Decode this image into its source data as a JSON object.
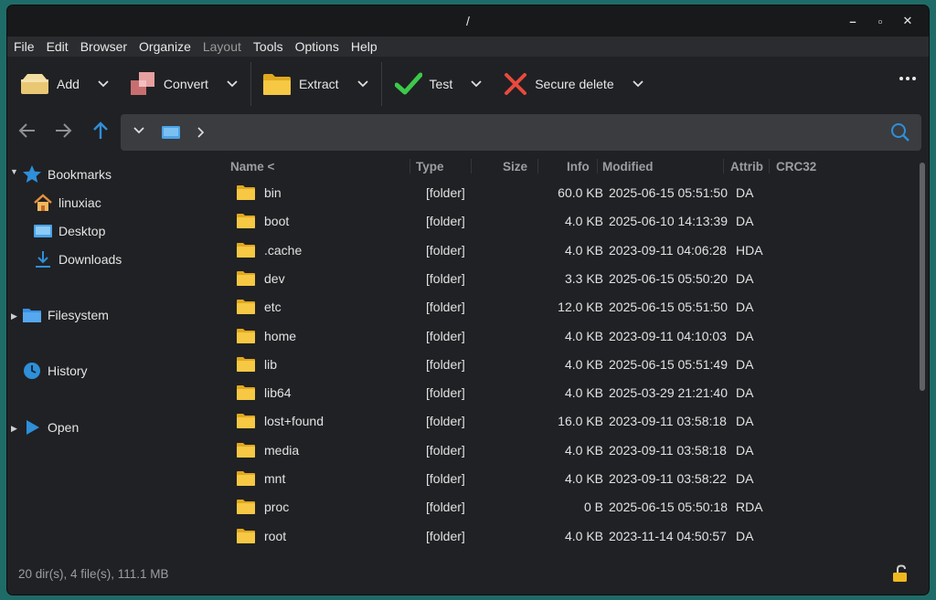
{
  "window": {
    "title": "/"
  },
  "menu": [
    "File",
    "Edit",
    "Browser",
    "Organize",
    "Layout",
    "Tools",
    "Options",
    "Help"
  ],
  "toolbar": {
    "add": "Add",
    "convert": "Convert",
    "extract": "Extract",
    "test": "Test",
    "secure_delete": "Secure delete"
  },
  "sidebar": {
    "bookmarks": "Bookmarks",
    "home": "linuxiac",
    "desktop": "Desktop",
    "downloads": "Downloads",
    "filesystem": "Filesystem",
    "history": "History",
    "open": "Open"
  },
  "columns": {
    "name": "Name <",
    "type": "Type",
    "size": "Size",
    "info": "Info",
    "modified": "Modified",
    "attrib": "Attrib",
    "crc": "CRC32"
  },
  "files": [
    {
      "name": "bin",
      "type": "[folder]",
      "size": "60.0 KB",
      "modified": "2025-06-15 05:51:50",
      "attrib": "DA"
    },
    {
      "name": "boot",
      "type": "[folder]",
      "size": "4.0 KB",
      "modified": "2025-06-10 14:13:39",
      "attrib": "DA"
    },
    {
      "name": ".cache",
      "type": "[folder]",
      "size": "4.0 KB",
      "modified": "2023-09-11 04:06:28",
      "attrib": "HDA"
    },
    {
      "name": "dev",
      "type": "[folder]",
      "size": "3.3 KB",
      "modified": "2025-06-15 05:50:20",
      "attrib": "DA"
    },
    {
      "name": "etc",
      "type": "[folder]",
      "size": "12.0 KB",
      "modified": "2025-06-15 05:51:50",
      "attrib": "DA"
    },
    {
      "name": "home",
      "type": "[folder]",
      "size": "4.0 KB",
      "modified": "2023-09-11 04:10:03",
      "attrib": "DA"
    },
    {
      "name": "lib",
      "type": "[folder]",
      "size": "4.0 KB",
      "modified": "2025-06-15 05:51:49",
      "attrib": "DA"
    },
    {
      "name": "lib64",
      "type": "[folder]",
      "size": "4.0 KB",
      "modified": "2025-03-29 21:21:40",
      "attrib": "DA"
    },
    {
      "name": "lost+found",
      "type": "[folder]",
      "size": "16.0 KB",
      "modified": "2023-09-11 03:58:18",
      "attrib": "DA"
    },
    {
      "name": "media",
      "type": "[folder]",
      "size": "4.0 KB",
      "modified": "2023-09-11 03:58:18",
      "attrib": "DA"
    },
    {
      "name": "mnt",
      "type": "[folder]",
      "size": "4.0 KB",
      "modified": "2023-09-11 03:58:22",
      "attrib": "DA"
    },
    {
      "name": "proc",
      "type": "[folder]",
      "size": "0 B",
      "modified": "2025-06-15 05:50:18",
      "attrib": "RDA"
    },
    {
      "name": "root",
      "type": "[folder]",
      "size": "4.0 KB",
      "modified": "2023-11-14 04:50:57",
      "attrib": "DA"
    }
  ],
  "status": {
    "summary": "20 dir(s), 4 file(s), 111.1 MB"
  },
  "colors": {
    "accent": "#2f8fd8",
    "folder": "#f5c342",
    "test": "#3cc94a",
    "delete": "#e84a3c"
  }
}
